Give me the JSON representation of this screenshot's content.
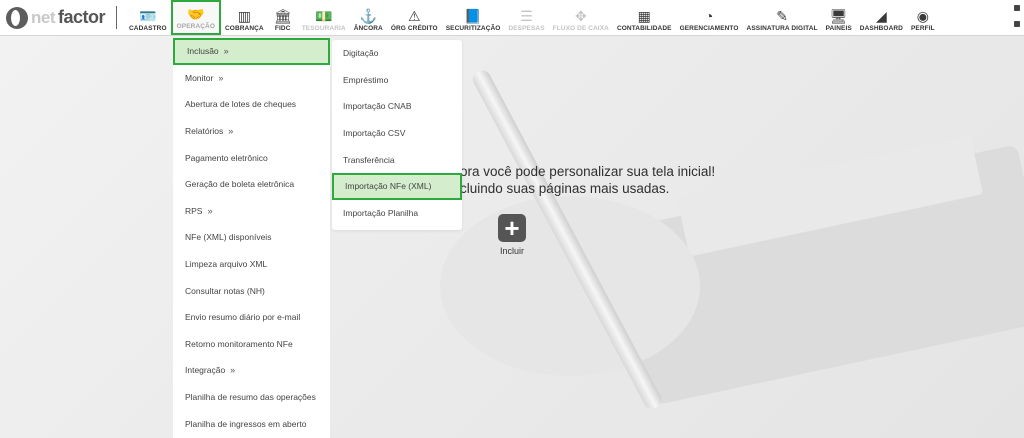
{
  "logo": {
    "part1": "net",
    "part2": "factor"
  },
  "toolbar": [
    {
      "label": "CADASTRO",
      "icon": "id-card-icon",
      "glyph": "🪪",
      "state": "normal"
    },
    {
      "label": "OPERAÇÃO",
      "icon": "handshake-icon",
      "glyph": "🤝",
      "state": "active"
    },
    {
      "label": "COBRANÇA",
      "icon": "barcode-icon",
      "glyph": "▥",
      "state": "normal"
    },
    {
      "label": "FIDC",
      "icon": "bank-icon",
      "glyph": "🏛",
      "state": "normal"
    },
    {
      "label": "TESOURARIA",
      "icon": "money-icon",
      "glyph": "💵",
      "state": "dim"
    },
    {
      "label": "ÂNCORA",
      "icon": "anchor-icon",
      "glyph": "⚓",
      "state": "normal"
    },
    {
      "label": "ÓRG CRÉDITO",
      "icon": "warning-icon",
      "glyph": "⚠",
      "state": "normal"
    },
    {
      "label": "SECURITIZAÇÃO",
      "icon": "book-icon",
      "glyph": "📘",
      "state": "normal"
    },
    {
      "label": "DESPESAS",
      "icon": "list-icon",
      "glyph": "☰",
      "state": "dim"
    },
    {
      "label": "FLUXO DE CAIXA",
      "icon": "expand-icon",
      "glyph": "✥",
      "state": "dim"
    },
    {
      "label": "CONTABILIDADE",
      "icon": "calculator-icon",
      "glyph": "▦",
      "state": "normal"
    },
    {
      "label": "GERENCIAMENTO",
      "icon": "pie-chart-icon",
      "glyph": "◔",
      "state": "normal"
    },
    {
      "label": "ASSINATURA DIGITAL",
      "icon": "edit-icon",
      "glyph": "✎",
      "state": "normal"
    },
    {
      "label": "PAINEIS",
      "icon": "monitor-icon",
      "glyph": "🖥",
      "state": "normal"
    },
    {
      "label": "DASHBOARD",
      "icon": "area-chart-icon",
      "glyph": "◢",
      "state": "normal"
    },
    {
      "label": "PERFIL",
      "icon": "user-circle-icon",
      "glyph": "◉",
      "state": "normal"
    }
  ],
  "menu_primary": [
    {
      "label": "Inclusão",
      "has_sub": true,
      "selected": true
    },
    {
      "label": "Monitor",
      "has_sub": true,
      "selected": false
    },
    {
      "label": "Abertura de lotes de cheques",
      "has_sub": false,
      "selected": false
    },
    {
      "label": "Relatórios",
      "has_sub": true,
      "selected": false
    },
    {
      "label": "Pagamento eletrônico",
      "has_sub": false,
      "selected": false
    },
    {
      "label": "Geração de boleta eletrônica",
      "has_sub": false,
      "selected": false
    },
    {
      "label": "RPS",
      "has_sub": true,
      "selected": false
    },
    {
      "label": "NFe (XML) disponíveis",
      "has_sub": false,
      "selected": false
    },
    {
      "label": "Limpeza arquivo XML",
      "has_sub": false,
      "selected": false
    },
    {
      "label": "Consultar notas (NH)",
      "has_sub": false,
      "selected": false
    },
    {
      "label": "Envio resumo diário por e-mail",
      "has_sub": false,
      "selected": false
    },
    {
      "label": "Retorno monitoramento NFe",
      "has_sub": false,
      "selected": false
    },
    {
      "label": "Integração",
      "has_sub": true,
      "selected": false
    },
    {
      "label": "Planilha de resumo das operações",
      "has_sub": false,
      "selected": false
    },
    {
      "label": "Planilha de ingressos em aberto",
      "has_sub": false,
      "selected": false
    }
  ],
  "menu_secondary": [
    {
      "label": "Digitação",
      "selected": false
    },
    {
      "label": "Empréstimo",
      "selected": false
    },
    {
      "label": "Importação CNAB",
      "selected": false
    },
    {
      "label": "Importação CSV",
      "selected": false
    },
    {
      "label": "Transferência",
      "selected": false
    },
    {
      "label": "Importação NFe (XML)",
      "selected": true
    },
    {
      "label": "Importação Planilha",
      "selected": false
    }
  ],
  "welcome": {
    "line1": "ora você pode personalizar sua tela inicial!",
    "line2": "cluindo suas páginas mais usadas."
  },
  "incluir": {
    "label": "Incluir",
    "glyph": "+"
  },
  "colors": {
    "highlight_border": "#2eaa3c",
    "highlight_fill": "#d4edcc"
  }
}
